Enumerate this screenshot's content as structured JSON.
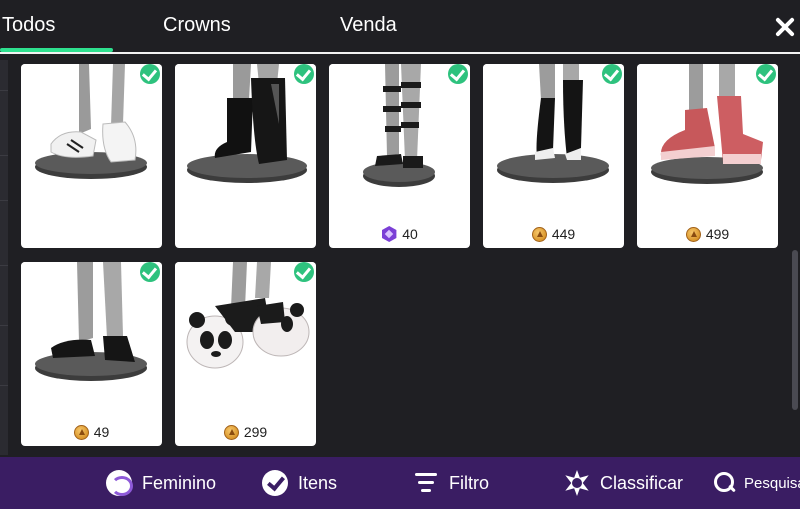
{
  "tabs": [
    {
      "label": "Todos",
      "active": true
    },
    {
      "label": "Crowns",
      "active": false
    },
    {
      "label": "Venda",
      "active": false
    }
  ],
  "accent_color": "#2ee08f",
  "items": [
    {
      "name": "white-sneakers",
      "owned": true,
      "price": "",
      "currency": ""
    },
    {
      "name": "black-boots",
      "owned": true,
      "price": "",
      "currency": ""
    },
    {
      "name": "strappy-sandals",
      "owned": true,
      "price": "40",
      "currency": "gem-icon"
    },
    {
      "name": "black-socks-heels",
      "owned": true,
      "price": "449",
      "currency": "coin-icon"
    },
    {
      "name": "pink-hightop-sneakers",
      "owned": true,
      "price": "499",
      "currency": "coin-icon"
    },
    {
      "name": "black-flats",
      "owned": true,
      "price": "49",
      "currency": "coin-icon"
    },
    {
      "name": "panda-slippers",
      "owned": true,
      "price": "299",
      "currency": "coin-icon"
    }
  ],
  "bottom_bar": {
    "gender_label": "Feminino",
    "items_label": "Itens",
    "filter_label": "Filtro",
    "sort_label": "Classificar",
    "search_label": "Pesquisa"
  }
}
